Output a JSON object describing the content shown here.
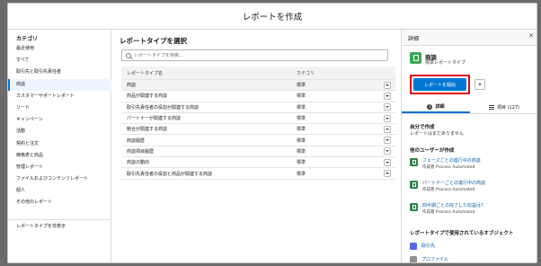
{
  "modal": {
    "title": "レポートを作成"
  },
  "sidebar": {
    "heading": "カテゴリ",
    "items": [
      {
        "label": "最近使用"
      },
      {
        "label": "すべて"
      },
      {
        "label": "取引先と取引先責任者"
      },
      {
        "label": "商談",
        "active": true
      },
      {
        "label": "カスタマーサポートレポート"
      },
      {
        "label": "リード"
      },
      {
        "label": "キャンペーン"
      },
      {
        "label": "活動"
      },
      {
        "label": "契約と注文"
      },
      {
        "label": "価格表と商品"
      },
      {
        "label": "管理レポート"
      },
      {
        "label": "ファイルおよびコンテンツレポート"
      },
      {
        "label": "個人"
      },
      {
        "label": "その他のレポート"
      }
    ],
    "footer": "レポートタイプを非表示"
  },
  "main": {
    "heading": "レポートタイプを選択",
    "search_placeholder": "レポートタイプを検索...",
    "columns": {
      "name": "レポートタイプ名",
      "category": "カテゴリ"
    },
    "rows": [
      {
        "name": "商談",
        "category": "標準",
        "selected": true
      },
      {
        "name": "商品が関連する商談",
        "category": "標準"
      },
      {
        "name": "取引先責任者の役割が関連する商談",
        "category": "標準"
      },
      {
        "name": "パートナーが関連する商談",
        "category": "標準"
      },
      {
        "name": "競合が関連する商談",
        "category": "標準"
      },
      {
        "name": "商談履歴",
        "category": "標準"
      },
      {
        "name": "商談項目履歴",
        "category": "標準"
      },
      {
        "name": "商談の動向",
        "category": "標準"
      },
      {
        "name": "取引先責任者の役割と商品が関連する商談",
        "category": "標準"
      }
    ]
  },
  "details": {
    "title": "詳細",
    "type_name": "商談",
    "type_sub": "標準レポートタイプ",
    "start_button": "レポートを開始",
    "tabs": {
      "details": "詳細",
      "fields": "項目 (127)"
    },
    "mine_title": "自分で作成",
    "mine_text": "レポートはまだありません",
    "others_title": "他のユーザーが作成",
    "reports": [
      {
        "name": "フェーズごとの進行中の商談",
        "by": "作成者 Process Automated"
      },
      {
        "name": "パートナーごとの進行中の商談",
        "by": "作成者 Process Automated"
      },
      {
        "name": "四半期ごとの完了した収益は?",
        "by": "作成者 Process Automated"
      }
    ],
    "objects_title": "レポートタイプで使用されているオブジェクト",
    "objects": [
      {
        "label": "取引先",
        "color": "#5867e8"
      },
      {
        "label": "プロファイル",
        "color": "#8f8f8f"
      }
    ]
  }
}
